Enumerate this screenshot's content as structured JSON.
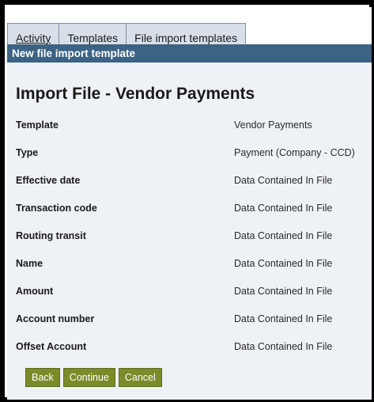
{
  "tabs": [
    {
      "label": "Activity",
      "active": true
    },
    {
      "label": "Templates",
      "active": false
    },
    {
      "label": "File import templates",
      "active": false
    }
  ],
  "header": {
    "title": "New file import template"
  },
  "form": {
    "title": "Import File - Vendor Payments",
    "fields": [
      {
        "label": "Template",
        "value": "Vendor Payments"
      },
      {
        "label": "Type",
        "value": "Payment (Company - CCD)"
      },
      {
        "label": "Effective date",
        "value": "Data Contained In File"
      },
      {
        "label": "Transaction code",
        "value": "Data Contained In File"
      },
      {
        "label": "Routing transit",
        "value": "Data Contained In File"
      },
      {
        "label": "Name",
        "value": "Data Contained In File"
      },
      {
        "label": "Amount",
        "value": "Data Contained In File"
      },
      {
        "label": "Account number",
        "value": "Data Contained In File"
      },
      {
        "label": "Offset Account",
        "value": "Data Contained In File"
      }
    ]
  },
  "buttons": {
    "back": "Back",
    "continue": "Continue",
    "cancel": "Cancel"
  },
  "colors": {
    "header_bar": "#3c6284",
    "button": "#7a8c2a",
    "panel": "#eef2f6",
    "tab": "#d8dfe9"
  }
}
